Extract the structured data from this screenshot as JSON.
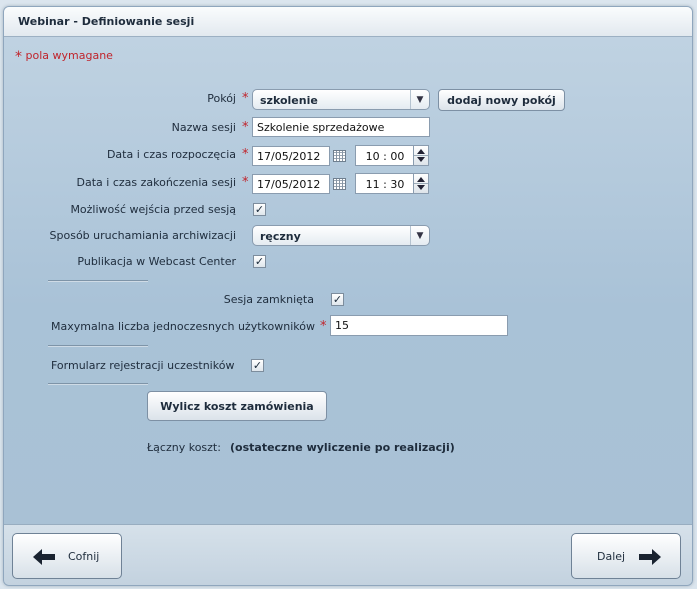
{
  "window": {
    "title": "Webinar - Definiowanie sesji"
  },
  "required_note": {
    "star": "*",
    "text": "pola wymagane"
  },
  "form": {
    "room": {
      "label": "Pokój",
      "value": "szkolenie",
      "add_button": "dodaj nowy pokój"
    },
    "session_name": {
      "label": "Nazwa sesji",
      "value": "Szkolenie sprzedażowe"
    },
    "start": {
      "label": "Data i czas rozpoczęcia",
      "date": "17/05/2012",
      "time": "10 : 00"
    },
    "end": {
      "label": "Data i czas zakończenia sesji",
      "date": "17/05/2012",
      "time": "11 : 30"
    },
    "early_entry": {
      "label": "Możliwość wejścia przed sesją",
      "checked": true
    },
    "archive_mode": {
      "label": "Sposób uruchamiania archiwizacji",
      "value": "ręczny"
    },
    "webcast": {
      "label": "Publikacja w Webcast Center",
      "checked": true
    },
    "closed_session": {
      "label": "Sesja zamknięta",
      "checked": true
    },
    "max_users": {
      "label": "Maxymalna liczba jednoczesnych użytkowników",
      "value": "15"
    },
    "registration_form": {
      "label": "Formularz rejestracji uczestników",
      "checked": true
    },
    "calculate_button": "Wylicz koszt zamówienia",
    "total_cost": {
      "label": "Łączny koszt:",
      "value": "(ostateczne wyliczenie po realizacji)"
    }
  },
  "footer": {
    "back_label": "Cofnij",
    "next_label": "Dalej"
  },
  "colors": {
    "required": "#c0242c",
    "panel": "#a9c2d7"
  },
  "icons": {
    "calendar": "calendar-icon",
    "back": "arrow-left-icon",
    "next": "arrow-right-icon",
    "check": "checkmark-icon"
  }
}
